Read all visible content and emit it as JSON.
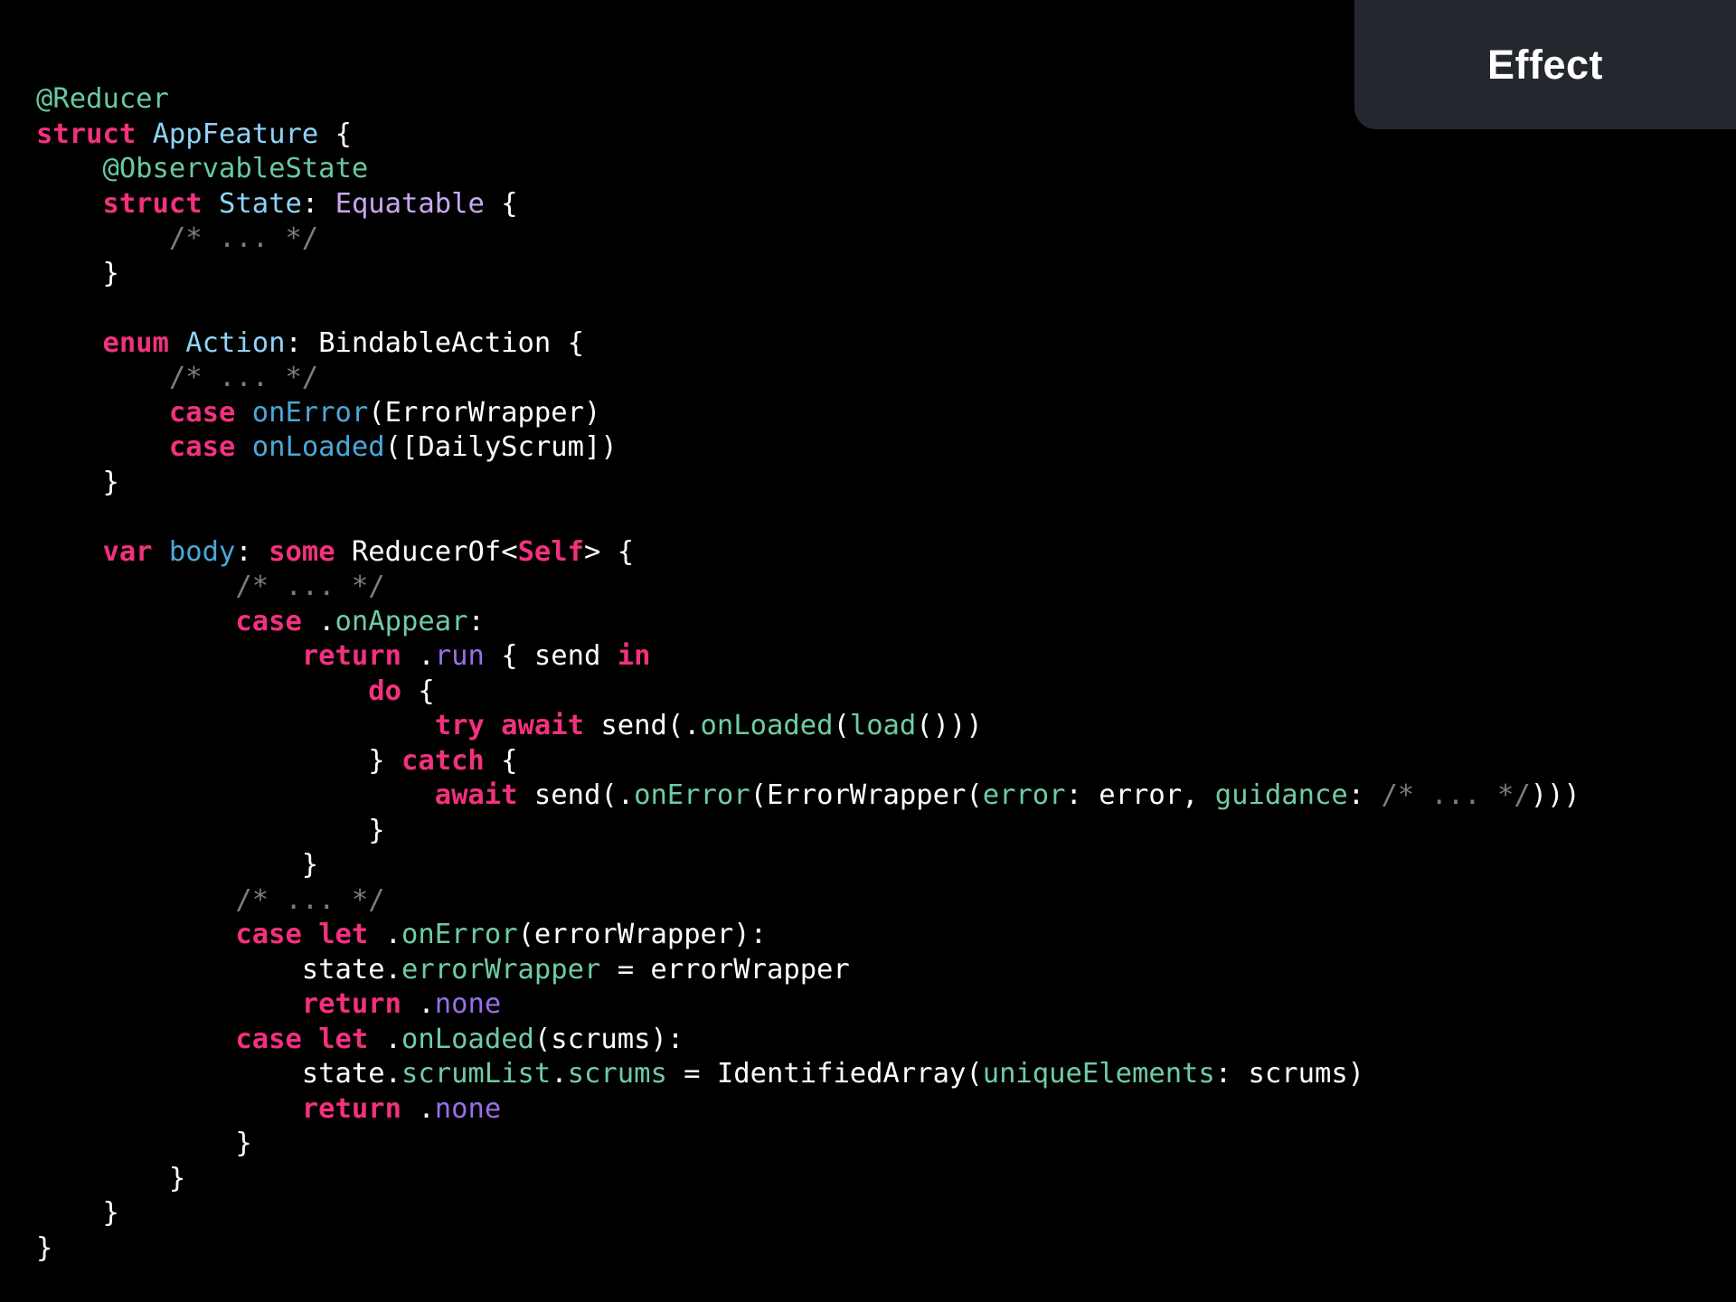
{
  "badge": {
    "label": "Effect"
  },
  "code": {
    "language": "swift",
    "colors": {
      "background": "#000000",
      "keyword": "#f2317e",
      "attribute": "#69c9a0",
      "type": "#8fd3f7",
      "protocol": "#c9a8f2",
      "comment": "#7c7c82",
      "function": "#4aa8d8",
      "member": "#6fcca3",
      "enum_case": "#9a6ee8",
      "plain": "#ffffff"
    },
    "lines": [
      [
        {
          "t": "attr",
          "v": "@Reducer"
        }
      ],
      [
        {
          "t": "kw",
          "v": "struct"
        },
        {
          "t": "plain",
          "v": " "
        },
        {
          "t": "type",
          "v": "AppFeature"
        },
        {
          "t": "plain",
          "v": " {"
        }
      ],
      [
        {
          "t": "plain",
          "v": "    "
        },
        {
          "t": "attr",
          "v": "@ObservableState"
        }
      ],
      [
        {
          "t": "plain",
          "v": "    "
        },
        {
          "t": "kw",
          "v": "struct"
        },
        {
          "t": "plain",
          "v": " "
        },
        {
          "t": "type",
          "v": "State"
        },
        {
          "t": "plain",
          "v": ": "
        },
        {
          "t": "proto",
          "v": "Equatable"
        },
        {
          "t": "plain",
          "v": " {"
        }
      ],
      [
        {
          "t": "plain",
          "v": "        "
        },
        {
          "t": "cm",
          "v": "/* ... */"
        }
      ],
      [
        {
          "t": "plain",
          "v": "    }"
        }
      ],
      [
        {
          "t": "plain",
          "v": ""
        }
      ],
      [
        {
          "t": "plain",
          "v": "    "
        },
        {
          "t": "kw",
          "v": "enum"
        },
        {
          "t": "plain",
          "v": " "
        },
        {
          "t": "type",
          "v": "Action"
        },
        {
          "t": "plain",
          "v": ": BindableAction {"
        }
      ],
      [
        {
          "t": "plain",
          "v": "        "
        },
        {
          "t": "cm",
          "v": "/* ... */"
        }
      ],
      [
        {
          "t": "plain",
          "v": "        "
        },
        {
          "t": "kw",
          "v": "case"
        },
        {
          "t": "plain",
          "v": " "
        },
        {
          "t": "fn",
          "v": "onError"
        },
        {
          "t": "plain",
          "v": "(ErrorWrapper)"
        }
      ],
      [
        {
          "t": "plain",
          "v": "        "
        },
        {
          "t": "kw",
          "v": "case"
        },
        {
          "t": "plain",
          "v": " "
        },
        {
          "t": "fn",
          "v": "onLoaded"
        },
        {
          "t": "plain",
          "v": "([DailyScrum])"
        }
      ],
      [
        {
          "t": "plain",
          "v": "    }"
        }
      ],
      [
        {
          "t": "plain",
          "v": ""
        }
      ],
      [
        {
          "t": "plain",
          "v": "    "
        },
        {
          "t": "kw",
          "v": "var"
        },
        {
          "t": "plain",
          "v": " "
        },
        {
          "t": "fn",
          "v": "body"
        },
        {
          "t": "plain",
          "v": ": "
        },
        {
          "t": "kw",
          "v": "some"
        },
        {
          "t": "plain",
          "v": " ReducerOf<"
        },
        {
          "t": "kw",
          "v": "Self"
        },
        {
          "t": "plain",
          "v": "> {"
        }
      ],
      [
        {
          "t": "plain",
          "v": "            "
        },
        {
          "t": "cm",
          "v": "/* ... */"
        }
      ],
      [
        {
          "t": "plain",
          "v": "            "
        },
        {
          "t": "kw",
          "v": "case"
        },
        {
          "t": "plain",
          "v": " ."
        },
        {
          "t": "mem",
          "v": "onAppear"
        },
        {
          "t": "plain",
          "v": ":"
        }
      ],
      [
        {
          "t": "plain",
          "v": "                "
        },
        {
          "t": "kw",
          "v": "return"
        },
        {
          "t": "plain",
          "v": " ."
        },
        {
          "t": "enum",
          "v": "run"
        },
        {
          "t": "plain",
          "v": " { send "
        },
        {
          "t": "kw",
          "v": "in"
        }
      ],
      [
        {
          "t": "plain",
          "v": "                    "
        },
        {
          "t": "kw",
          "v": "do"
        },
        {
          "t": "plain",
          "v": " {"
        }
      ],
      [
        {
          "t": "plain",
          "v": "                        "
        },
        {
          "t": "kw",
          "v": "try"
        },
        {
          "t": "plain",
          "v": " "
        },
        {
          "t": "kw",
          "v": "await"
        },
        {
          "t": "plain",
          "v": " send(."
        },
        {
          "t": "mem",
          "v": "onLoaded"
        },
        {
          "t": "plain",
          "v": "("
        },
        {
          "t": "mem",
          "v": "load"
        },
        {
          "t": "plain",
          "v": "()))"
        }
      ],
      [
        {
          "t": "plain",
          "v": "                    } "
        },
        {
          "t": "kw",
          "v": "catch"
        },
        {
          "t": "plain",
          "v": " {"
        }
      ],
      [
        {
          "t": "plain",
          "v": "                        "
        },
        {
          "t": "kw",
          "v": "await"
        },
        {
          "t": "plain",
          "v": " send(."
        },
        {
          "t": "mem",
          "v": "onError"
        },
        {
          "t": "plain",
          "v": "(ErrorWrapper("
        },
        {
          "t": "mem",
          "v": "error"
        },
        {
          "t": "plain",
          "v": ": error, "
        },
        {
          "t": "mem",
          "v": "guidance"
        },
        {
          "t": "plain",
          "v": ": "
        },
        {
          "t": "cm",
          "v": "/* ... */"
        },
        {
          "t": "plain",
          "v": ")))"
        }
      ],
      [
        {
          "t": "plain",
          "v": "                    }"
        }
      ],
      [
        {
          "t": "plain",
          "v": "                }"
        }
      ],
      [
        {
          "t": "plain",
          "v": "            "
        },
        {
          "t": "cm",
          "v": "/* ... */"
        }
      ],
      [
        {
          "t": "plain",
          "v": "            "
        },
        {
          "t": "kw",
          "v": "case"
        },
        {
          "t": "plain",
          "v": " "
        },
        {
          "t": "kw",
          "v": "let"
        },
        {
          "t": "plain",
          "v": " ."
        },
        {
          "t": "mem",
          "v": "onError"
        },
        {
          "t": "plain",
          "v": "(errorWrapper):"
        }
      ],
      [
        {
          "t": "plain",
          "v": "                state."
        },
        {
          "t": "mem",
          "v": "errorWrapper"
        },
        {
          "t": "plain",
          "v": " = errorWrapper"
        }
      ],
      [
        {
          "t": "plain",
          "v": "                "
        },
        {
          "t": "kw",
          "v": "return"
        },
        {
          "t": "plain",
          "v": " ."
        },
        {
          "t": "enum",
          "v": "none"
        }
      ],
      [
        {
          "t": "plain",
          "v": "            "
        },
        {
          "t": "kw",
          "v": "case"
        },
        {
          "t": "plain",
          "v": " "
        },
        {
          "t": "kw",
          "v": "let"
        },
        {
          "t": "plain",
          "v": " ."
        },
        {
          "t": "mem",
          "v": "onLoaded"
        },
        {
          "t": "plain",
          "v": "(scrums):"
        }
      ],
      [
        {
          "t": "plain",
          "v": "                state."
        },
        {
          "t": "mem",
          "v": "scrumList"
        },
        {
          "t": "plain",
          "v": "."
        },
        {
          "t": "mem",
          "v": "scrums"
        },
        {
          "t": "plain",
          "v": " = IdentifiedArray("
        },
        {
          "t": "mem",
          "v": "uniqueElements"
        },
        {
          "t": "plain",
          "v": ": scrums)"
        }
      ],
      [
        {
          "t": "plain",
          "v": "                "
        },
        {
          "t": "kw",
          "v": "return"
        },
        {
          "t": "plain",
          "v": " ."
        },
        {
          "t": "enum",
          "v": "none"
        }
      ],
      [
        {
          "t": "plain",
          "v": "            }"
        }
      ],
      [
        {
          "t": "plain",
          "v": "        }"
        }
      ],
      [
        {
          "t": "plain",
          "v": "    }"
        }
      ],
      [
        {
          "t": "plain",
          "v": "}"
        }
      ]
    ]
  }
}
